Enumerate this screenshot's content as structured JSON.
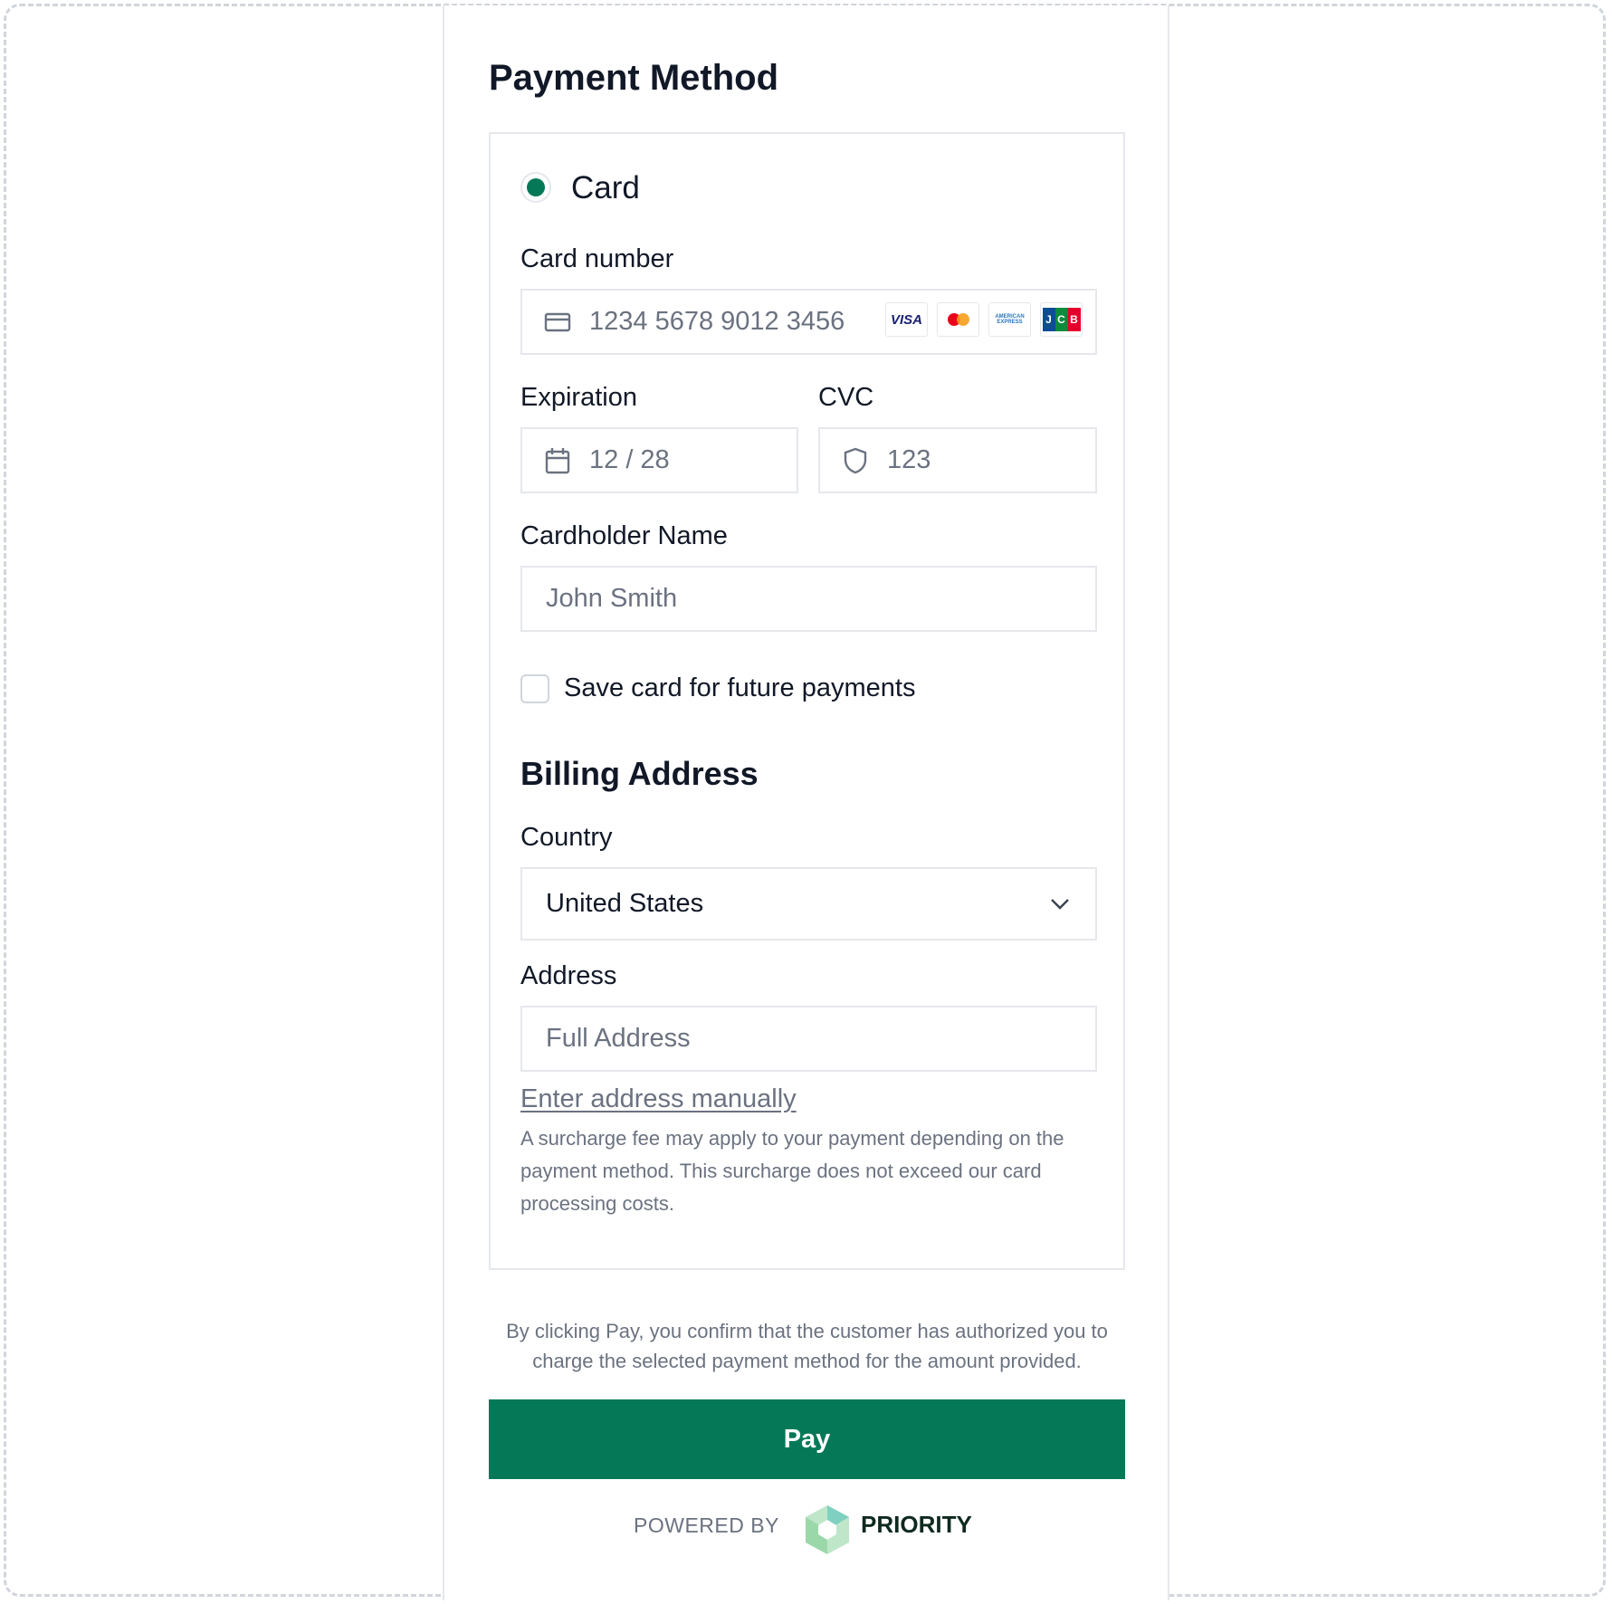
{
  "page": {
    "title": "Payment Method"
  },
  "method": {
    "label": "Card",
    "selected": true
  },
  "card_number": {
    "label": "Card number",
    "placeholder": "1234 5678 9012 3456",
    "brands": [
      "VISA",
      "Mastercard",
      "AMERICAN EXPRESS",
      "JCB"
    ]
  },
  "expiration": {
    "label": "Expiration",
    "placeholder": "12 / 28"
  },
  "cvc": {
    "label": "CVC",
    "placeholder": "123"
  },
  "cardholder": {
    "label": "Cardholder Name",
    "placeholder": "John Smith"
  },
  "save_card": {
    "label": "Save card for future payments",
    "checked": false
  },
  "billing": {
    "title": "Billing Address",
    "country_label": "Country",
    "country_value": "United States",
    "address_label": "Address",
    "address_placeholder": "Full Address",
    "manual_link": "Enter address manually"
  },
  "notice": "A surcharge fee may apply to your payment depending on the payment method. This surcharge does not exceed our card processing costs.",
  "consent": "By clicking Pay, you confirm that the customer has authorized you to charge the selected payment method for the amount provided.",
  "pay_button": "Pay",
  "footer": {
    "powered_by": "POWERED BY",
    "brand": "PRIORITY"
  },
  "colors": {
    "accent": "#047857",
    "border": "#e5e7eb",
    "muted_text": "#6b7280"
  }
}
